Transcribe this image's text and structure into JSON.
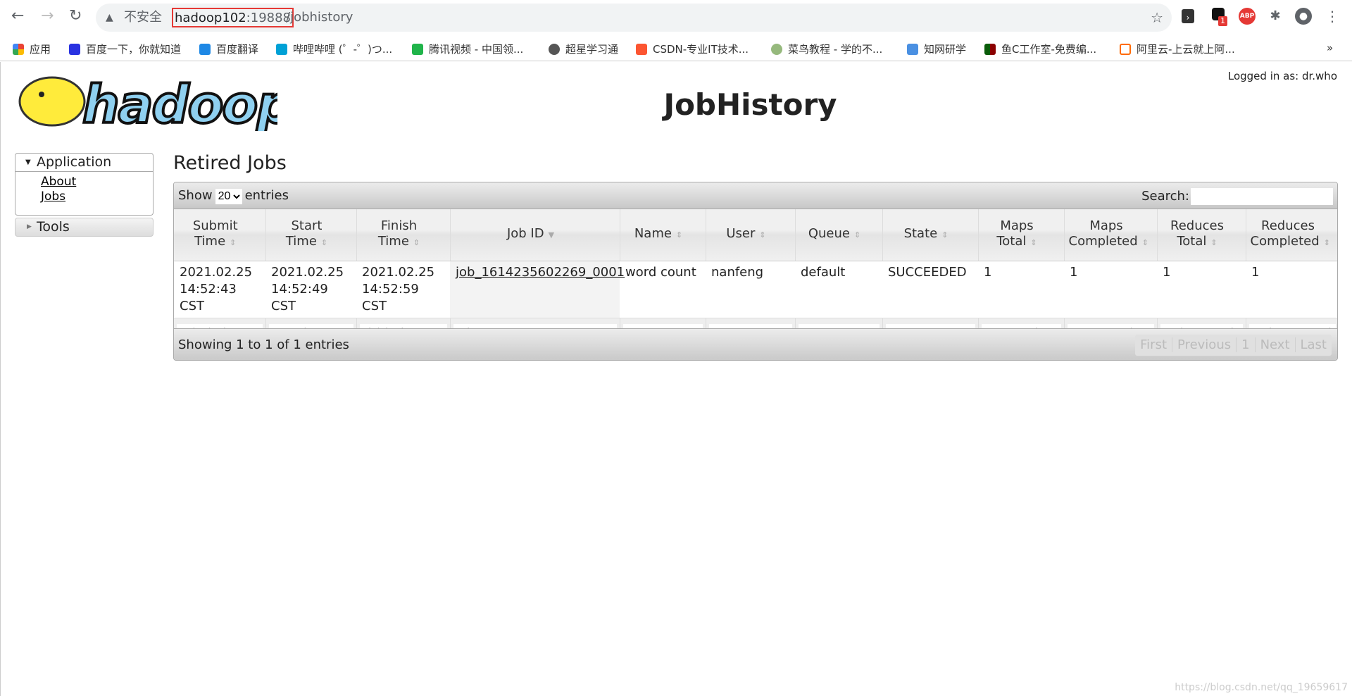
{
  "browser": {
    "insecure_label": "不安全",
    "url_host": "hadoop102",
    "url_port": ":19888",
    "url_path": "/jobhistory",
    "extension_badge": "1",
    "abp_label": "ABP",
    "bookmarks": [
      {
        "label": "应用",
        "color": "#ea4335"
      },
      {
        "label": "百度一下，你就知道",
        "color": "#2932e1"
      },
      {
        "label": "百度翻译",
        "color": "#1e88e5"
      },
      {
        "label": "哔哩哔哩 (゜-゜)つ...",
        "color": "#00a1d6"
      },
      {
        "label": "腾讯视频 - 中国领...",
        "color": "#20b44a"
      },
      {
        "label": "超星学习通",
        "color": "#555555"
      },
      {
        "label": "CSDN-专业IT技术...",
        "color": "#fc5531"
      },
      {
        "label": "菜鸟教程 - 学的不...",
        "color": "#96b97d"
      },
      {
        "label": "知网研学",
        "color": "#4a90e2"
      },
      {
        "label": "鱼C工作室-免费编...",
        "color": "#8b0000"
      },
      {
        "label": "阿里云-上云就上阿...",
        "color": "#ff6a00"
      }
    ],
    "more": "»"
  },
  "header": {
    "logo_text": "hadoop",
    "title": "JobHistory",
    "logged_in": "Logged in as: dr.who"
  },
  "sidebar": {
    "application": "Application",
    "items": [
      {
        "label": "About"
      },
      {
        "label": "Jobs"
      }
    ],
    "tools": "Tools"
  },
  "main": {
    "heading": "Retired Jobs",
    "show_label": "Show",
    "entries_label": "entries",
    "page_size": "20",
    "search_label": "Search:",
    "columns": [
      "Submit Time",
      "Start Time",
      "Finish Time",
      "Job ID",
      "Name",
      "User",
      "Queue",
      "State",
      "Maps Total",
      "Maps Completed",
      "Reduces Total",
      "Reduces Completed"
    ],
    "rows": [
      {
        "submit_date": "2021.02.25",
        "submit_time": "14:52:43 CST",
        "start_date": "2021.02.25",
        "start_time": "14:52:49 CST",
        "finish_date": "2021.02.25",
        "finish_time": "14:52:59 CST",
        "job_id": "job_1614235602269_0001",
        "name": "word count",
        "user": "nanfeng",
        "queue": "default",
        "state": "SUCCEEDED",
        "maps_total": "1",
        "maps_completed": "1",
        "reduces_total": "1",
        "reduces_completed": "1"
      }
    ],
    "filters": [
      "Submit Time",
      "Start Time",
      "Finish Time",
      "Job ID",
      "Name",
      "User",
      "Queue",
      "State",
      "Maps Total",
      "Maps Completed",
      "Reduces Total",
      "Reduces Completed"
    ],
    "info": "Showing 1 to 1 of 1 entries",
    "pager": {
      "first": "First",
      "previous": "Previous",
      "page": "1",
      "next": "Next",
      "last": "Last"
    }
  },
  "watermark": "https://blog.csdn.net/qq_19659617"
}
